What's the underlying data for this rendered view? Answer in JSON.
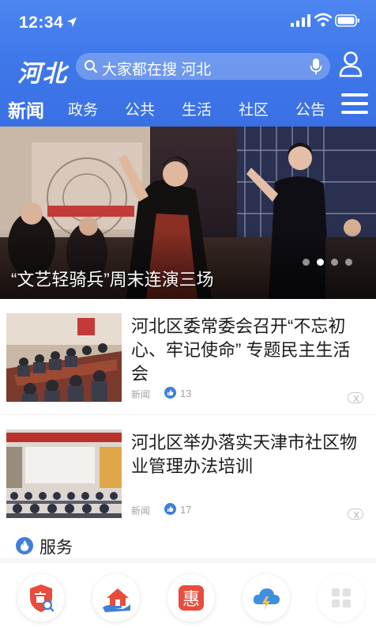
{
  "status_bar": {
    "time": "12:34"
  },
  "header": {
    "logo": "河北",
    "search_placeholder": "大家都在搜 河北",
    "tabs": [
      {
        "label": "新闻",
        "active": true
      },
      {
        "label": "政务",
        "active": false
      },
      {
        "label": "公共",
        "active": false
      },
      {
        "label": "生活",
        "active": false
      },
      {
        "label": "社区",
        "active": false
      },
      {
        "label": "公告",
        "active": false
      }
    ]
  },
  "banner": {
    "caption": "“文艺轻骑兵”周末连演三场",
    "slides": 4,
    "active_slide": 1
  },
  "news": [
    {
      "title": "河北区委常委会召开“不忘初心、牢记使命” 专题民主生活会",
      "source": "新闻",
      "likes": "13"
    },
    {
      "title": "河北区举办落实天津市社区物业管理办法培训",
      "source": "新闻",
      "likes": "17"
    }
  ],
  "services": {
    "title": "服务",
    "items": [
      {
        "icon": "shield-search-icon"
      },
      {
        "icon": "house-hand-icon"
      },
      {
        "icon": "discount-icon",
        "glyph": "惠"
      },
      {
        "icon": "cloud-lightning-icon"
      },
      {
        "icon": "grid-icon"
      }
    ]
  },
  "colors": {
    "brand": "#3f78ea",
    "accent": "#e84c3d",
    "text": "#1c1c1c"
  }
}
